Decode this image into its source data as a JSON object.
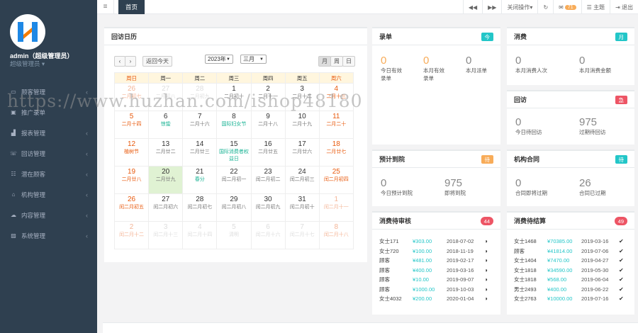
{
  "user": {
    "name": "admin（超级管理员）",
    "role": "超级管理员 ▾"
  },
  "nav": [
    {
      "label": "顾客管理",
      "icon": "monitor-icon"
    },
    {
      "label": "推广录单",
      "icon": "form-icon"
    },
    {
      "label": "报表管理",
      "icon": "chart-icon"
    },
    {
      "label": "回访管理",
      "icon": "phone-icon"
    },
    {
      "label": "潜在顾客",
      "icon": "sitemap-icon"
    },
    {
      "label": "机构管理",
      "icon": "bank-icon"
    },
    {
      "label": "内容管理",
      "icon": "cloud-icon"
    },
    {
      "label": "系统管理",
      "icon": "image-icon"
    }
  ],
  "topbar": {
    "tab": "首页",
    "close_ops": "关闭操作▾",
    "msg_count": "71",
    "theme": "主题",
    "logout": "退出"
  },
  "calendar": {
    "title": "回访日历",
    "today_btn": "返回今天",
    "year": "2023年",
    "month": "三月",
    "views": [
      "月",
      "周",
      "日"
    ],
    "weekdays": [
      "周日",
      "周一",
      "周二",
      "周三",
      "周四",
      "周五",
      "周六"
    ],
    "weeks": [
      [
        [
          "26",
          "二月初七",
          1
        ],
        [
          "27",
          "二月初八",
          1
        ],
        [
          "28",
          "二月初九",
          1
        ],
        [
          "1",
          "二月初十",
          0
        ],
        [
          "2",
          "二月十一",
          0
        ],
        [
          "3",
          "二月十二",
          0
        ],
        [
          "4",
          "二月十三",
          0
        ]
      ],
      [
        [
          "5",
          "二月十四",
          0
        ],
        [
          "6",
          "惊蛰",
          0
        ],
        [
          "7",
          "二月十六",
          0
        ],
        [
          "8",
          "国际妇女节",
          0
        ],
        [
          "9",
          "二月十八",
          0
        ],
        [
          "10",
          "二月十九",
          0
        ],
        [
          "11",
          "二月二十",
          0
        ]
      ],
      [
        [
          "12",
          "植树节",
          0
        ],
        [
          "13",
          "二月廿二",
          0
        ],
        [
          "14",
          "二月廿三",
          0
        ],
        [
          "15",
          "国际消费者权益日",
          0
        ],
        [
          "16",
          "二月廿五",
          0
        ],
        [
          "17",
          "二月廿六",
          0
        ],
        [
          "18",
          "二月廿七",
          0
        ]
      ],
      [
        [
          "19",
          "二月廿八",
          0
        ],
        [
          "20",
          "二月廿九",
          0
        ],
        [
          "21",
          "春分",
          0
        ],
        [
          "22",
          "闰二月初一",
          0
        ],
        [
          "23",
          "闰二月初二",
          0
        ],
        [
          "24",
          "闰二月初三",
          0
        ],
        [
          "25",
          "闰二月初四",
          0
        ]
      ],
      [
        [
          "26",
          "闰二月初五",
          0
        ],
        [
          "27",
          "闰二月初六",
          0
        ],
        [
          "28",
          "闰二月初七",
          0
        ],
        [
          "29",
          "闰二月初八",
          0
        ],
        [
          "30",
          "闰二月初九",
          0
        ],
        [
          "31",
          "闰二月初十",
          0
        ],
        [
          "1",
          "闰二月十一",
          1
        ]
      ],
      [
        [
          "2",
          "闰二月十二",
          1
        ],
        [
          "3",
          "闰二月十三",
          1
        ],
        [
          "4",
          "闰二月十四",
          1
        ],
        [
          "5",
          "清明",
          1
        ],
        [
          "6",
          "闰二月十六",
          1
        ],
        [
          "7",
          "闰二月十七",
          1
        ],
        [
          "8",
          "闰二月十八",
          1
        ]
      ]
    ]
  },
  "luodan": {
    "title": "录单",
    "tag": "今",
    "stats": [
      {
        "num": "0",
        "label": "今日有效\n录单"
      },
      {
        "num": "0",
        "label": "本月有效\n录单"
      },
      {
        "num": "0",
        "label": "本月派单"
      }
    ]
  },
  "xiaofei": {
    "title": "消费",
    "tag": "月",
    "stats": [
      {
        "num": "0",
        "label": "本月消费人次"
      },
      {
        "num": "0",
        "label": "本月消费金额"
      }
    ]
  },
  "huifang": {
    "title": "回访",
    "tag": "急",
    "stats": [
      {
        "num": "0",
        "label": "今日待回访"
      },
      {
        "num": "975",
        "label": "过期待回访"
      }
    ]
  },
  "daoyuan": {
    "title": "预计到院",
    "tag": "待",
    "stats": [
      {
        "num": "0",
        "label": "今日预计到院"
      },
      {
        "num": "975",
        "label": "即将到院"
      }
    ]
  },
  "hetong": {
    "title": "机构合同",
    "tag": "待",
    "stats": [
      {
        "num": "0",
        "label": "合同即将过期"
      },
      {
        "num": "26",
        "label": "合同已过期"
      }
    ]
  },
  "shenhe": {
    "title": "消费待审核",
    "tag": "44",
    "rows": [
      [
        "女士171",
        "¥303.00",
        "2018-07-02"
      ],
      [
        "女士720",
        "¥100.00",
        "2018-11-19"
      ],
      [
        "顾客",
        "¥481.00",
        "2019-02-17"
      ],
      [
        "顾客",
        "¥400.00",
        "2019-03-16"
      ],
      [
        "顾客",
        "¥10.00",
        "2019-09-07"
      ],
      [
        "顾客",
        "¥1000.00",
        "2019-10-03"
      ],
      [
        "女士4032",
        "¥200.00",
        "2020-01-04"
      ]
    ]
  },
  "jiesuan": {
    "title": "消费待结算",
    "tag": "49",
    "rows": [
      [
        "女士1468",
        "¥70385.00",
        "2019-03-16"
      ],
      [
        "顾客",
        "¥41814.00",
        "2019-07-06"
      ],
      [
        "女士1404",
        "¥7470.00",
        "2019-04-27"
      ],
      [
        "女士1818",
        "¥34590.00",
        "2019-05-30"
      ],
      [
        "女士1818",
        "¥568.00",
        "2019-06-04"
      ],
      [
        "男士2493",
        "¥400.00",
        "2019-06-22"
      ],
      [
        "女士2763",
        "¥10000.00",
        "2019-07-16"
      ]
    ]
  },
  "watermark": "https://www.huzhan.com/ishop48180"
}
